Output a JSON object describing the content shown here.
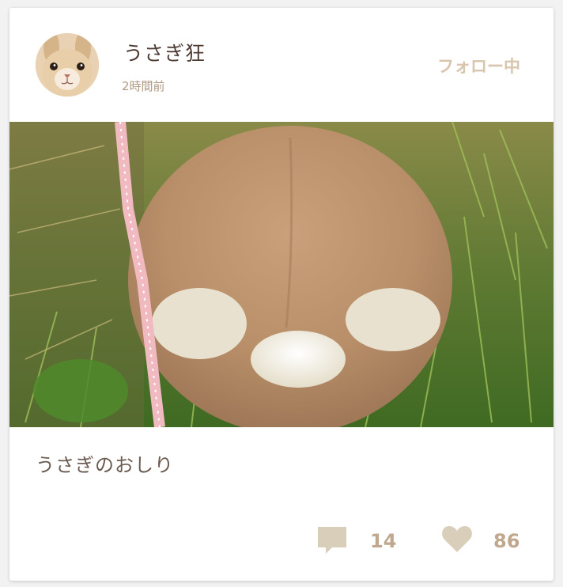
{
  "post": {
    "user": {
      "name": "うさぎ狂",
      "time_ago": "2時間前",
      "avatar_icon": "rabbit-avatar"
    },
    "follow_label": "フォロー中",
    "photo": {
      "subject": "rabbit-back-on-grass-photo"
    },
    "caption": "うさぎのおしり",
    "stats": {
      "comments": "14",
      "likes": "86"
    },
    "icons": {
      "comment": "comment-icon",
      "like": "heart-icon"
    },
    "colors": {
      "accent": "#c0a88f",
      "follow": "#d8c5ad",
      "icon": "#d9ceb9",
      "text": "#4d3b33"
    }
  }
}
